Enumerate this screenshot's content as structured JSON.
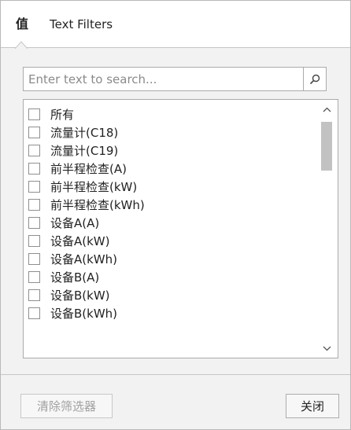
{
  "tabs": {
    "values_label": "值",
    "text_filters_label": "Text Filters"
  },
  "search": {
    "placeholder": "Enter text to search...",
    "value": ""
  },
  "list": {
    "items": [
      {
        "label": "所有",
        "checked": false
      },
      {
        "label": "流量计(C18)",
        "checked": false
      },
      {
        "label": "流量计(C19)",
        "checked": false
      },
      {
        "label": "前半程检查(A)",
        "checked": false
      },
      {
        "label": "前半程检查(kW)",
        "checked": false
      },
      {
        "label": "前半程检查(kWh)",
        "checked": false
      },
      {
        "label": "设备A(A)",
        "checked": false
      },
      {
        "label": "设备A(kW)",
        "checked": false
      },
      {
        "label": "设备A(kWh)",
        "checked": false
      },
      {
        "label": "设备B(A)",
        "checked": false
      },
      {
        "label": "设备B(kW)",
        "checked": false
      },
      {
        "label": "设备B(kWh)",
        "checked": false
      }
    ]
  },
  "footer": {
    "clear_filter_label": "清除筛选器",
    "close_label": "关闭"
  },
  "icons": {
    "search": "search-icon",
    "scroll_up": "chevron-up-icon",
    "scroll_down": "chevron-down-icon"
  },
  "colors": {
    "panel_bg": "#f2f2f2",
    "border": "#ababab",
    "disabled_text": "#a0a0a0"
  }
}
